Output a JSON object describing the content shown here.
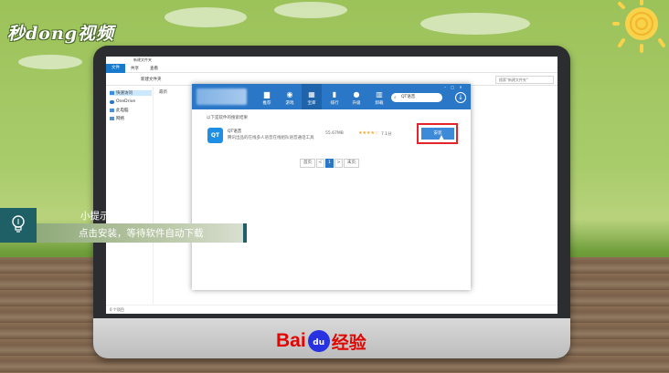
{
  "brand": {
    "logo": "秒dong视频"
  },
  "explorer": {
    "title": "新建文件夹",
    "menu": [
      "文件",
      "共享",
      "查看"
    ],
    "path": "新建文件夹",
    "search_placeholder": "搜索\"新建文件夹\"",
    "sidebar": [
      "快速访问",
      "OneDrive",
      "此电脑",
      "网络"
    ],
    "content_label": "最新",
    "status": "0 个项目"
  },
  "store": {
    "nav": [
      {
        "label": "推荐",
        "icon": "home-icon"
      },
      {
        "label": "游戏",
        "icon": "gamepad-icon"
      },
      {
        "label": "宝库",
        "icon": "grid-icon",
        "active": true
      },
      {
        "label": "排行",
        "icon": "bar-chart-icon"
      },
      {
        "label": "升级",
        "icon": "upgrade-icon"
      },
      {
        "label": "卸载",
        "icon": "trash-icon"
      }
    ],
    "search_value": "QT语音",
    "result_heading": "以下是软件的搜索结果",
    "app": {
      "icon_text": "QT",
      "name": "QT语音",
      "description": "腾讯出品的在线多人语音在线组队语音通话工具",
      "size": "55.67MB",
      "stars": "★★★★☆",
      "score": "7.1分",
      "install_label": "安装"
    },
    "pager": [
      "首页",
      "<",
      "1",
      ">",
      "末页"
    ]
  },
  "tip": {
    "title": "小提示",
    "text": "点击安装，等待软件自动下载"
  },
  "footer_logo": {
    "bai": "Bai",
    "du": "du",
    "jingyan": "经验"
  }
}
